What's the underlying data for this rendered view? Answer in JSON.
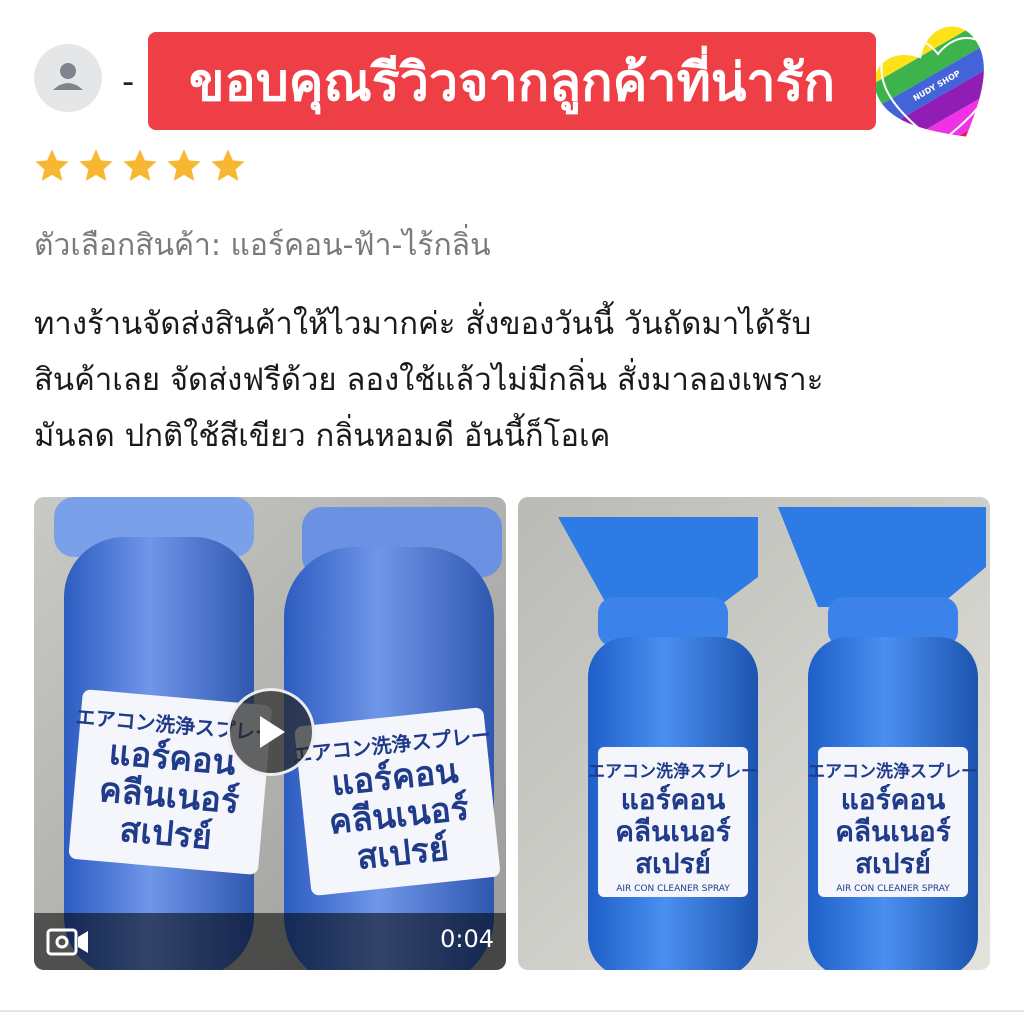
{
  "reviewer": {
    "name_prefix": "-"
  },
  "banner": {
    "text": "ขอบคุณรีวิวจากลูกค้าที่น่ารัก"
  },
  "logo": {
    "text": "NUDY SHOP"
  },
  "rating": {
    "stars": 5,
    "max": 5
  },
  "variation": {
    "text": "ตัวเลือกสินค้า: แอร์คอน-ฟ้า-ไร้กลิ่น"
  },
  "review": {
    "lines": [
      "ทางร้านจัดส่งสินค้าให้ไวมากค่ะ สั่งของวันนี้ วันถัดมาได้รับ",
      "สินค้าเลย จัดส่งฟรีด้วย ลองใช้แล้วไม่มีกลิ่น สั่งมาลองเพราะ",
      "มันลด ปกติใช้สีเขียว กลิ่นหอมดี อันนี้ก็โอเค"
    ]
  },
  "media": {
    "video": {
      "duration": "0:04"
    },
    "product_label": {
      "jp": "エアコン洗浄スプレー",
      "line1": "แอร์คอน",
      "line2": "คลีนเนอร์",
      "line3": "สเปรย์",
      "en": "AIR CON CLEANER SPRAY"
    }
  },
  "colors": {
    "banner_bg": "#ee3f47",
    "star": "#f7b731",
    "can_blue": "#3f6fd0"
  },
  "icons": {
    "avatar": "person-icon",
    "star": "star-icon",
    "play": "play-icon",
    "video": "video-camera-icon"
  }
}
